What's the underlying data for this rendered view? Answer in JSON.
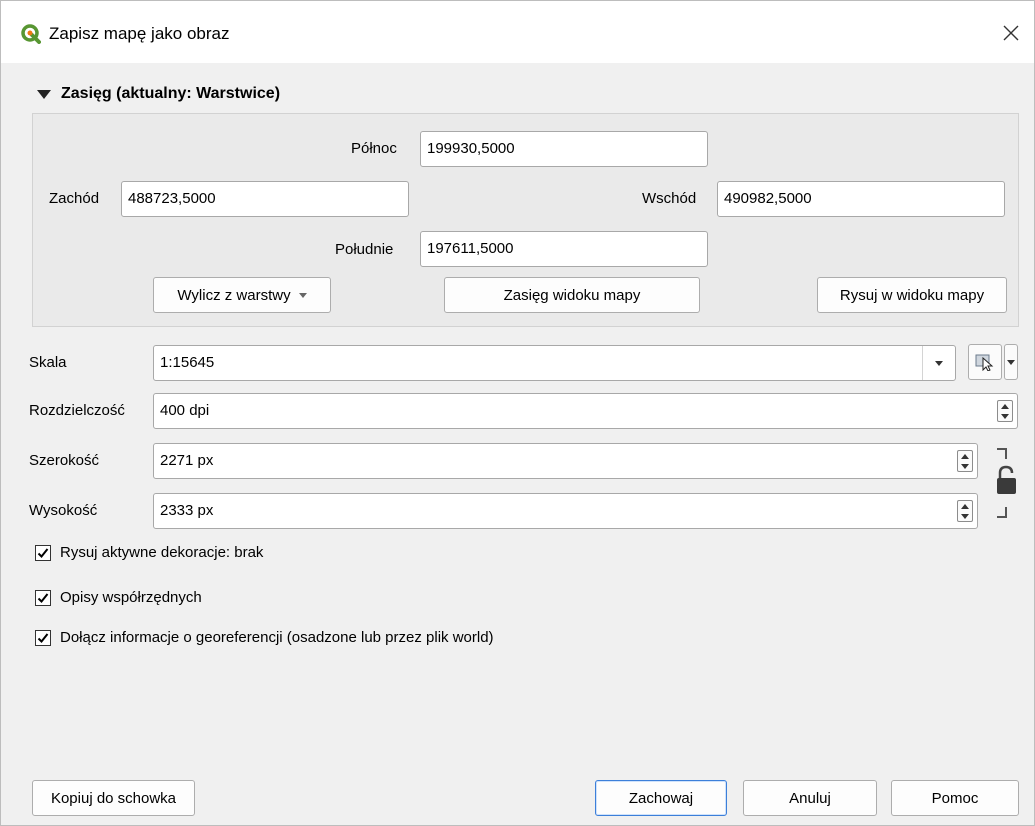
{
  "window": {
    "title": "Zapisz mapę jako obraz",
    "app_icon": "qgis-logo-icon",
    "close_icon": "close-icon",
    "close_glyph": "✕"
  },
  "extent": {
    "header": "Zasięg (aktualny: Warstwice)",
    "north_label": "Północ",
    "north_value": "199930,5000",
    "west_label": "Zachód",
    "west_value": "488723,5000",
    "east_label": "Wschód",
    "east_value": "490982,5000",
    "south_label": "Południe",
    "south_value": "197611,5000",
    "calc_from_layer_button": "Wylicz z warstwy",
    "map_view_extent_button": "Zasięg widoku mapy",
    "draw_on_canvas_button": "Rysuj w widoku mapy"
  },
  "scale": {
    "label": "Skala",
    "value": "1:15645"
  },
  "resolution": {
    "label": "Rozdzielczość",
    "value": "400 dpi"
  },
  "width": {
    "label": "Szerokość",
    "value": "2271 px"
  },
  "height": {
    "label": "Wysokość",
    "value": "2333 px"
  },
  "checkboxes": [
    {
      "label": "Rysuj aktywne dekoracje: brak",
      "checked": true
    },
    {
      "label": "Opisy współrzędnych",
      "checked": true
    },
    {
      "label": "Dołącz informacje o georeferencji (osadzone lub przez plik world)",
      "checked": true
    }
  ],
  "footer": {
    "copy_button": "Kopiuj do schowka",
    "save_button": "Zachowaj",
    "cancel_button": "Anuluj",
    "help_button": "Pomoc"
  },
  "colors": {
    "qgis_green": "#589632",
    "qgis_yellow": "#ee7913",
    "default_button_border": "#3c7fd9"
  }
}
